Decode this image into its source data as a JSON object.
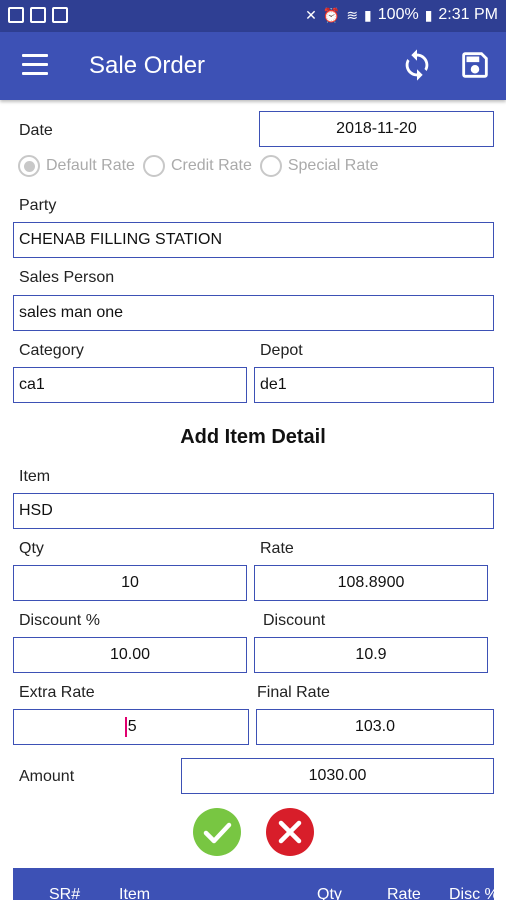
{
  "status_bar": {
    "left_icons": [
      "image-icon",
      "hd-icon",
      "facebook-icon"
    ],
    "battery": "100%",
    "time": "2:31 PM"
  },
  "app_bar": {
    "title": "Sale Order"
  },
  "form": {
    "date_label": "Date",
    "date_value": "2018-11-20",
    "rate_options": [
      "Default Rate",
      "Credit Rate",
      "Special Rate"
    ],
    "rate_selected": "Default Rate",
    "party_label": "Party",
    "party_value": "CHENAB FILLING STATION",
    "sales_person_label": "Sales Person",
    "sales_person_value": "sales man one",
    "category_label": "Category",
    "category_value": "ca1",
    "depot_label": "Depot",
    "depot_value": "de1"
  },
  "item_detail": {
    "title": "Add Item Detail",
    "item_label": "Item",
    "item_value": "HSD",
    "qty_label": "Qty",
    "qty_value": "10",
    "rate_label": "Rate",
    "rate_value": "108.8900",
    "discount_pct_label": "Discount %",
    "discount_pct_value": "10.00",
    "discount_label": "Discount",
    "discount_value": "10.9",
    "extra_rate_label": "Extra Rate",
    "extra_rate_value": "5",
    "final_rate_label": "Final Rate",
    "final_rate_value": "103.0",
    "amount_label": "Amount",
    "amount_value": "1030.00"
  },
  "table": {
    "headers": [
      "SR#",
      "Item",
      "Qty",
      "Rate",
      "Disc %"
    ]
  },
  "colors": {
    "primary": "#3d51b5",
    "status_bar": "#2f3f93",
    "confirm": "#78c642",
    "cancel": "#d81e2a"
  }
}
